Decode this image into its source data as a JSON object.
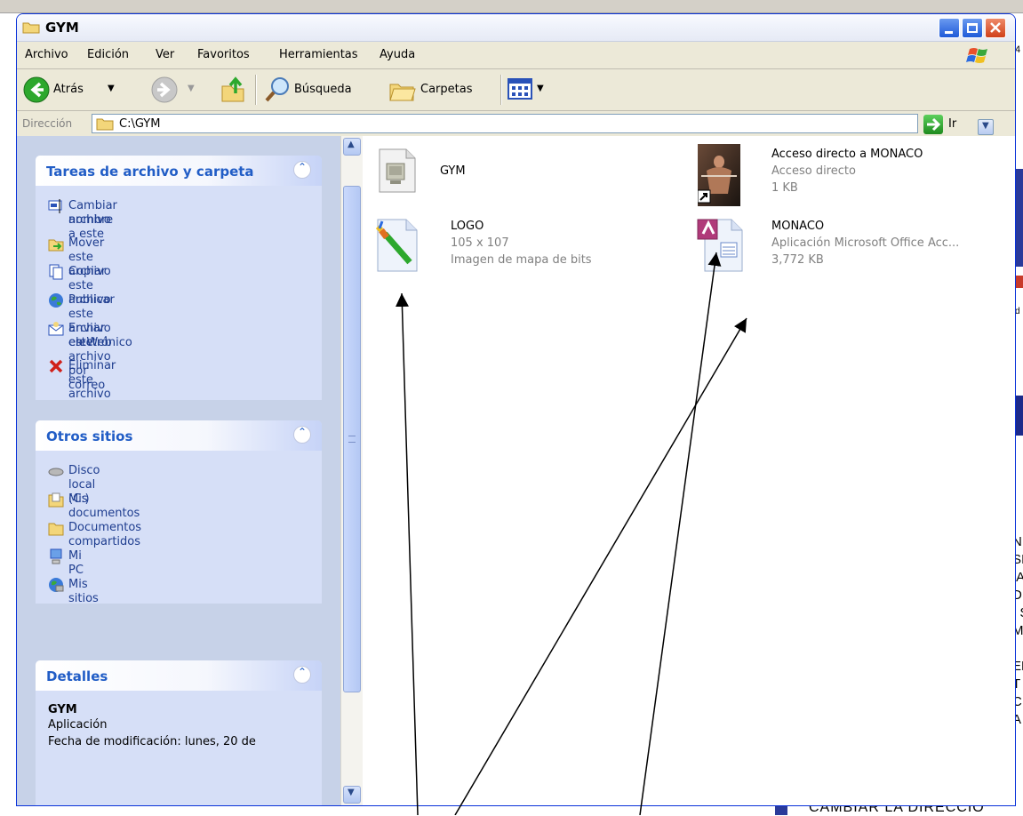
{
  "background": {
    "right_letters": [
      "N",
      "SI",
      "IA",
      "D",
      ", S",
      "M",
      "",
      "EN",
      "T",
      "C",
      "A"
    ],
    "side_top": "4",
    "side_mid": "d",
    "bottom_text": "CAMBIAR LA DIRECCIO"
  },
  "window": {
    "title": "GYM",
    "title_icon": "folder-icon",
    "controls": [
      "minimize",
      "maximize",
      "close"
    ]
  },
  "menubar": {
    "items": [
      "Archivo",
      "Edición",
      "Ver",
      "Favoritos",
      "Herramientas",
      "Ayuda"
    ]
  },
  "toolbar": {
    "back_label": "Atrás",
    "search_label": "Búsqueda",
    "folders_label": "Carpetas"
  },
  "address": {
    "label": "Dirección",
    "value": "C:\\GYM",
    "go_label": "Ir"
  },
  "task_pane": {
    "file_tasks": {
      "title": "Tareas de archivo y carpeta",
      "items": [
        {
          "label": "Cambiar nombre a este",
          "label2": "archivo",
          "icon": "rename-icon"
        },
        {
          "label": "Mover este archivo",
          "icon": "move-icon"
        },
        {
          "label": "Copiar este archivo",
          "icon": "copy-icon"
        },
        {
          "label": "Publicar este archivo en Web",
          "icon": "globe-icon"
        },
        {
          "label": "Enviar este archivo por correo",
          "label2": "electrónico",
          "icon": "email-icon"
        },
        {
          "label": "Eliminar este archivo",
          "icon": "delete-icon"
        }
      ]
    },
    "other_places": {
      "title": "Otros sitios",
      "items": [
        {
          "label": "Disco local (C:)",
          "icon": "drive-icon"
        },
        {
          "label": "Mis documentos",
          "icon": "my-documents-icon"
        },
        {
          "label": "Documentos compartidos",
          "icon": "folder-icon"
        },
        {
          "label": "Mi PC",
          "icon": "my-computer-icon"
        },
        {
          "label": "Mis sitios de red",
          "icon": "network-icon"
        }
      ]
    },
    "details": {
      "title": "Detalles",
      "name": "GYM",
      "type": "Aplicación",
      "partial_line": "Fecha de modificación: lunes, 20 de"
    }
  },
  "files": [
    {
      "name": "GYM",
      "icon": "application-icon"
    },
    {
      "name": "Acceso directo a MONACO",
      "type": "Acceso directo",
      "size": "1 KB",
      "icon": "shortcut-photo-icon"
    },
    {
      "name": "LOGO",
      "dimensions": "105 x 107",
      "type": "Imagen de mapa de bits",
      "icon": "bitmap-icon"
    },
    {
      "name": "MONACO",
      "type": "Aplicación Microsoft Office Acc...",
      "size": "3,772 KB",
      "icon": "access-db-icon"
    }
  ],
  "colors": {
    "xp_title_blue": "#0831d9",
    "task_link": "#215dc6",
    "task_panel": "#d6dff7",
    "window_bg": "#ece9d8"
  }
}
